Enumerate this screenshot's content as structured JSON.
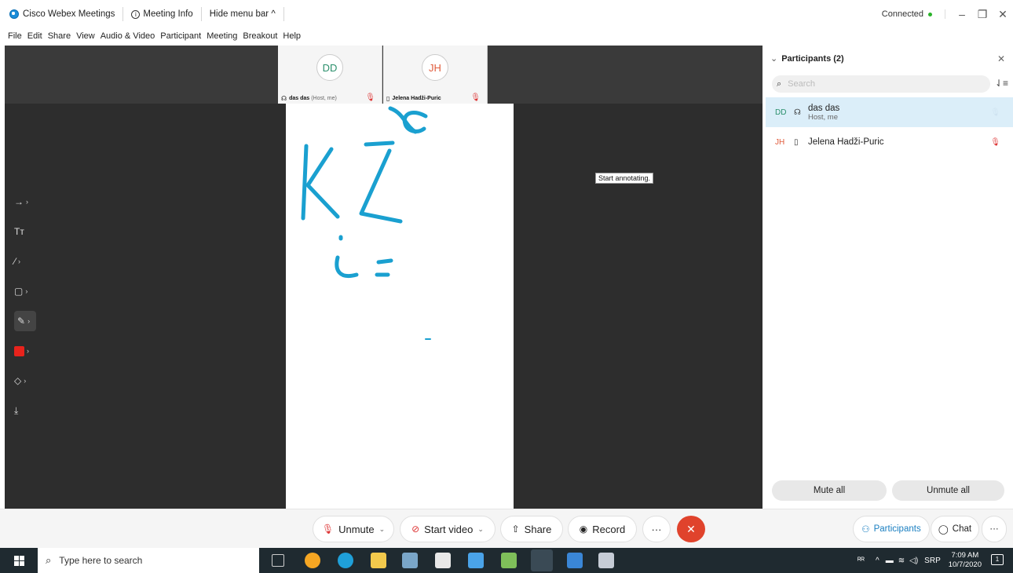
{
  "titlebar": {
    "app_name": "Cisco Webex Meetings",
    "meeting_info": "Meeting Info",
    "hide_menu": "Hide menu bar ^",
    "status": "Connected"
  },
  "menu": [
    "File",
    "Edit",
    "Share",
    "View",
    "Audio & Video",
    "Participant",
    "Meeting",
    "Breakout",
    "Help"
  ],
  "thumbnails": [
    {
      "initials": "DD",
      "name": "das das",
      "tag": "(Host, me)"
    },
    {
      "initials": "JH",
      "name": "Jelena Hadži-Puric",
      "tag": ""
    }
  ],
  "tooltip": "Start annotating.",
  "participants": {
    "title": "Participants (2)",
    "search_placeholder": "Search",
    "list": [
      {
        "initials": "DD",
        "name": "das das",
        "sub": "Host, me"
      },
      {
        "initials": "JH",
        "name": "Jelena Hadži-Puric",
        "sub": ""
      }
    ],
    "mute_all": "Mute all",
    "unmute_all": "Unmute all"
  },
  "controls": {
    "unmute": "Unmute",
    "start_video": "Start video",
    "share": "Share",
    "record": "Record",
    "participants": "Participants",
    "chat": "Chat"
  },
  "taskbar": {
    "search_placeholder": "Type here to search",
    "lang": "SRP",
    "time": "7:09 AM",
    "date": "10/7/2020",
    "notifications": "1"
  },
  "colors": {
    "ink": "#1aa0d0",
    "annotation_color": "#e8231c",
    "end_call": "#e0432c",
    "selected_row": "#dbeef9"
  }
}
